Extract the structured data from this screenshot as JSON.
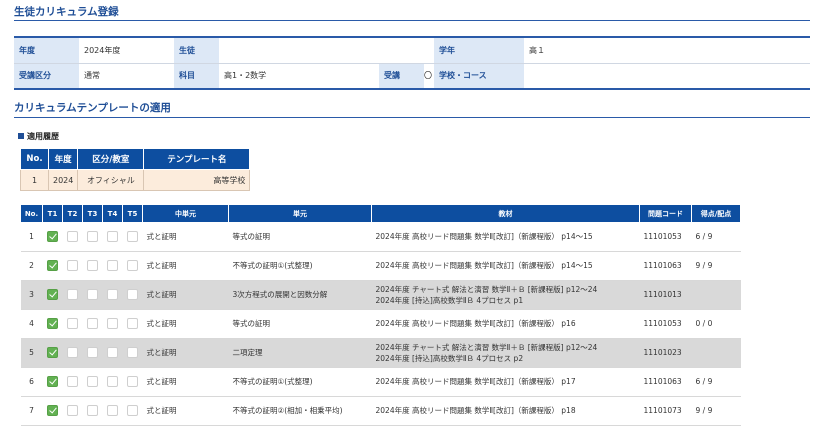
{
  "page": {
    "title": "生徒カリキュラム登録",
    "template_section_title": "カリキュラムテンプレートの適用"
  },
  "info": {
    "nendo_label": "年度",
    "nendo_value": "2024年度",
    "student_label": "生徒",
    "student_value": "",
    "grade_label": "学年",
    "grade_value": "高１",
    "kubun_label": "受講区分",
    "kubun_value": "通常",
    "subject_label": "科目",
    "subject_value": "高1・2数学",
    "juko_label": "受講",
    "juko_value": "〇",
    "school_label": "学校・コース",
    "school_value": ""
  },
  "history": {
    "heading": "適用履歴",
    "headers": [
      "No.",
      "年度",
      "区分/教室",
      "テンプレート名"
    ],
    "rows": [
      {
        "no": "1",
        "year": "2024",
        "kubun": "オフィシャル",
        "name": "高等学校"
      }
    ]
  },
  "curriculum": {
    "headers": [
      "No.",
      "T1",
      "T2",
      "T3",
      "T4",
      "T5",
      "中単元",
      "単元",
      "教材",
      "問題コード",
      "得点/配点"
    ],
    "rows": [
      {
        "no": "1",
        "t": [
          true,
          false,
          false,
          false,
          false
        ],
        "chutan": "式と証明",
        "tangen": "等式の証明",
        "kyozai": [
          "2024年度 高校リード問題集 数学Ⅱ[改訂]（新課程版） p14～15"
        ],
        "code": "11101053",
        "score": "6 / 9",
        "gray": false
      },
      {
        "no": "2",
        "t": [
          true,
          false,
          false,
          false,
          false
        ],
        "chutan": "式と証明",
        "tangen": "不等式の証明①(式整理)",
        "kyozai": [
          "2024年度 高校リード問題集 数学Ⅱ[改訂]（新課程版） p14～15"
        ],
        "code": "11101063",
        "score": "9 / 9",
        "gray": false
      },
      {
        "no": "3",
        "t": [
          true,
          false,
          false,
          false,
          false
        ],
        "chutan": "式と証明",
        "tangen": "3次方程式の展開と因数分解",
        "kyozai": [
          "2024年度 チャート式 解法と演習 数学Ⅱ＋Ｂ [新課程版] p12～24",
          "2024年度 [持込]高校数学ⅡＢ 4プロセス p1"
        ],
        "code": "11101013",
        "score": "",
        "gray": true
      },
      {
        "no": "4",
        "t": [
          true,
          false,
          false,
          false,
          false
        ],
        "chutan": "式と証明",
        "tangen": "等式の証明",
        "kyozai": [
          "2024年度 高校リード問題集 数学Ⅱ[改訂]（新課程版） p16"
        ],
        "code": "11101053",
        "score": "0 / 0",
        "gray": false
      },
      {
        "no": "5",
        "t": [
          true,
          false,
          false,
          false,
          false
        ],
        "chutan": "式と証明",
        "tangen": "二項定理",
        "kyozai": [
          "2024年度 チャート式 解法と演習 数学Ⅱ＋Ｂ [新課程版] p12～24",
          "2024年度 [持込]高校数学ⅡＢ 4プロセス p2"
        ],
        "code": "11101023",
        "score": "",
        "gray": true
      },
      {
        "no": "6",
        "t": [
          true,
          false,
          false,
          false,
          false
        ],
        "chutan": "式と証明",
        "tangen": "不等式の証明①(式整理)",
        "kyozai": [
          "2024年度 高校リード問題集 数学Ⅱ[改訂]（新課程版） p17"
        ],
        "code": "11101063",
        "score": "6 / 9",
        "gray": false
      },
      {
        "no": "7",
        "t": [
          true,
          false,
          false,
          false,
          false
        ],
        "chutan": "式と証明",
        "tangen": "不等式の証明②(相加・相乗平均)",
        "kyozai": [
          "2024年度 高校リード問題集 数学Ⅱ[改訂]（新課程版） p18"
        ],
        "code": "11101073",
        "score": "9 / 9",
        "gray": false
      }
    ]
  }
}
